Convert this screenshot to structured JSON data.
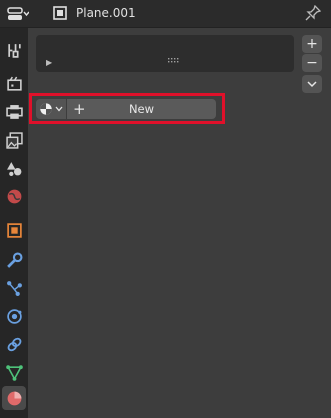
{
  "header": {
    "object_name": "Plane.001",
    "editor_type_icon": "properties-editor-icon",
    "object_icon": "object-icon",
    "pin_icon": "pin-icon"
  },
  "sidebar": {
    "tabs": [
      {
        "name": "tool",
        "icon": "tool-icon",
        "color": "#c8c8c8"
      },
      {
        "name": "render",
        "icon": "render-icon",
        "color": "#c8c8c8"
      },
      {
        "name": "output",
        "icon": "output-icon",
        "color": "#c8c8c8"
      },
      {
        "name": "view-layer",
        "icon": "view-layer-icon",
        "color": "#c8c8c8"
      },
      {
        "name": "scene",
        "icon": "scene-icon",
        "color": "#c8c8c8"
      },
      {
        "name": "world",
        "icon": "world-icon",
        "color": "#d05050"
      },
      {
        "name": "object",
        "icon": "object-icon",
        "color": "#e8863a"
      },
      {
        "name": "modifiers",
        "icon": "wrench-icon",
        "color": "#6aa0e0"
      },
      {
        "name": "particles",
        "icon": "particles-icon",
        "color": "#6aa0e0"
      },
      {
        "name": "physics",
        "icon": "physics-icon",
        "color": "#6aa0e0"
      },
      {
        "name": "constraints",
        "icon": "constraints-icon",
        "color": "#6aa0e0"
      },
      {
        "name": "data",
        "icon": "mesh-data-icon",
        "color": "#4ec27a"
      },
      {
        "name": "material",
        "icon": "material-icon",
        "color": "#e06a6a",
        "active": true
      }
    ]
  },
  "material_slots": {
    "add_label": "+",
    "remove_label": "−",
    "menu_label": "⌄"
  },
  "material": {
    "new_button_label": "New",
    "plus_label": "+"
  },
  "colors": {
    "highlight": "#e0102a",
    "panel_bg": "#3d3d3d"
  }
}
